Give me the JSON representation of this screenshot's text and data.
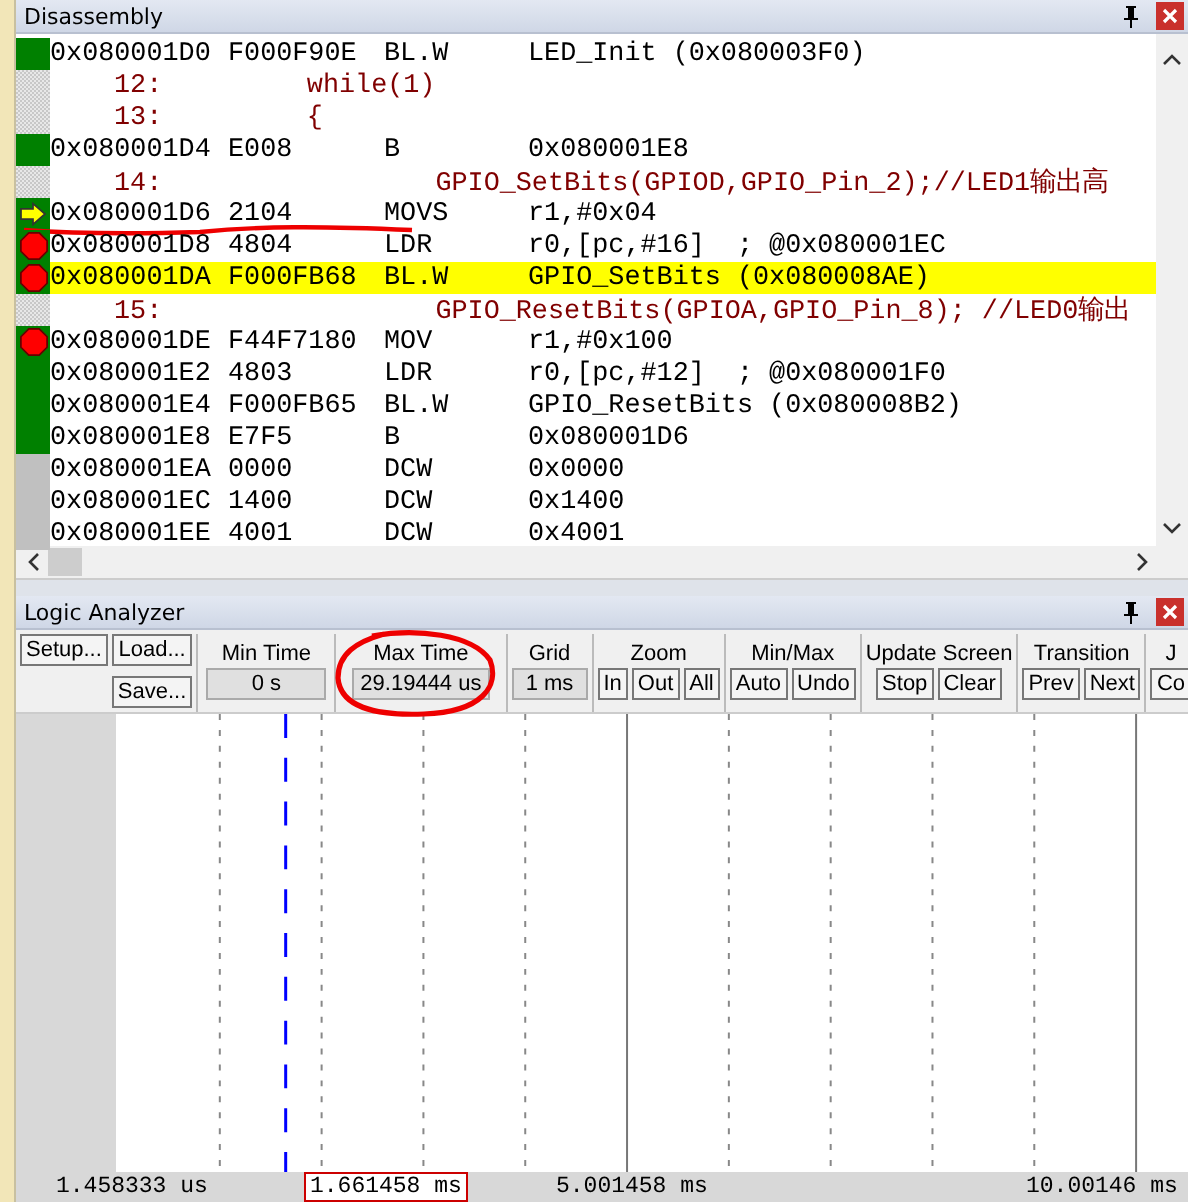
{
  "disassembly": {
    "title": "Disassembly",
    "rows": [
      {
        "kind": "code",
        "executed": true,
        "breakpoint": false,
        "current": false,
        "selected": false,
        "underlined": false,
        "address": "0x080001D0",
        "opcode": "F000F90E",
        "mnemonic": "BL.W",
        "operand": "LED_Init (0x080003F0)"
      },
      {
        "kind": "source",
        "selected": false,
        "underlined": false,
        "text": "12:         while(1)"
      },
      {
        "kind": "source",
        "selected": false,
        "underlined": false,
        "text": "13:         {"
      },
      {
        "kind": "code",
        "executed": true,
        "breakpoint": false,
        "current": false,
        "selected": false,
        "underlined": false,
        "address": "0x080001D4",
        "opcode": "E008",
        "mnemonic": "B",
        "operand": "0x080001E8"
      },
      {
        "kind": "source",
        "selected": false,
        "underlined": false,
        "text": "14:                 GPIO_SetBits(GPIOD,GPIO_Pin_2);//LED1输出高"
      },
      {
        "kind": "code",
        "executed": true,
        "breakpoint": false,
        "current": true,
        "selected": false,
        "underlined": true,
        "address": "0x080001D6",
        "opcode": "2104",
        "mnemonic": "MOVS",
        "operand": "r1,#0x04"
      },
      {
        "kind": "code",
        "executed": true,
        "breakpoint": true,
        "current": false,
        "selected": false,
        "underlined": false,
        "address": "0x080001D8",
        "opcode": "4804",
        "mnemonic": "LDR",
        "operand": "r0,[pc,#16]  ; @0x080001EC"
      },
      {
        "kind": "code",
        "executed": true,
        "breakpoint": true,
        "current": false,
        "selected": true,
        "underlined": false,
        "address": "0x080001DA",
        "opcode": "F000FB68",
        "mnemonic": "BL.W",
        "operand": "GPIO_SetBits (0x080008AE)"
      },
      {
        "kind": "source",
        "selected": false,
        "underlined": false,
        "text": "15:                 GPIO_ResetBits(GPIOA,GPIO_Pin_8); //LED0输出"
      },
      {
        "kind": "code",
        "executed": true,
        "breakpoint": true,
        "current": false,
        "selected": false,
        "underlined": false,
        "address": "0x080001DE",
        "opcode": "F44F7180",
        "mnemonic": "MOV",
        "operand": "r1,#0x100"
      },
      {
        "kind": "code",
        "executed": true,
        "breakpoint": false,
        "current": false,
        "selected": false,
        "underlined": false,
        "address": "0x080001E2",
        "opcode": "4803",
        "mnemonic": "LDR",
        "operand": "r0,[pc,#12]  ; @0x080001F0"
      },
      {
        "kind": "code",
        "executed": true,
        "breakpoint": false,
        "current": false,
        "selected": false,
        "underlined": false,
        "address": "0x080001E4",
        "opcode": "F000FB65",
        "mnemonic": "BL.W",
        "operand": "GPIO_ResetBits (0x080008B2)"
      },
      {
        "kind": "code",
        "executed": true,
        "breakpoint": false,
        "current": false,
        "selected": false,
        "underlined": false,
        "address": "0x080001E8",
        "opcode": "E7F5",
        "mnemonic": "B",
        "operand": "0x080001D6"
      },
      {
        "kind": "data",
        "breakpoint": false,
        "current": false,
        "selected": false,
        "underlined": false,
        "address": "0x080001EA",
        "opcode": "0000",
        "mnemonic": "DCW",
        "operand": "0x0000"
      },
      {
        "kind": "data",
        "breakpoint": false,
        "current": false,
        "selected": false,
        "underlined": false,
        "address": "0x080001EC",
        "opcode": "1400",
        "mnemonic": "DCW",
        "operand": "0x1400"
      },
      {
        "kind": "data",
        "breakpoint": false,
        "current": false,
        "selected": false,
        "underlined": false,
        "address": "0x080001EE",
        "opcode": "4001",
        "mnemonic": "DCW",
        "operand": "0x4001"
      }
    ]
  },
  "logic_analyzer": {
    "title": "Logic Analyzer",
    "file_buttons": [
      "Setup...",
      "Load...",
      "Save..."
    ],
    "readouts": [
      {
        "label": "Min Time",
        "value": "0 s",
        "circled": false
      },
      {
        "label": "Max Time",
        "value": "29.19444 us",
        "circled": true
      },
      {
        "label": "Grid",
        "value": "1 ms",
        "circled": false
      }
    ],
    "button_groups": [
      {
        "label": "Zoom",
        "buttons": [
          "In",
          "Out",
          "All"
        ]
      },
      {
        "label": "Min/Max",
        "buttons": [
          "Auto",
          "Undo"
        ]
      },
      {
        "label": "Update Screen",
        "buttons": [
          "Stop",
          "Clear"
        ]
      },
      {
        "label": "Transition",
        "buttons": [
          "Prev",
          "Next"
        ]
      },
      {
        "label": "J",
        "buttons": [
          "Co"
        ]
      }
    ],
    "axis_labels": [
      {
        "text": "1.458333 us",
        "boxed": false
      },
      {
        "text": "1.661458 ms",
        "boxed": true
      },
      {
        "text": "5.001458 ms",
        "boxed": false
      },
      {
        "text": "10.00146 ms",
        "boxed": false
      }
    ]
  }
}
